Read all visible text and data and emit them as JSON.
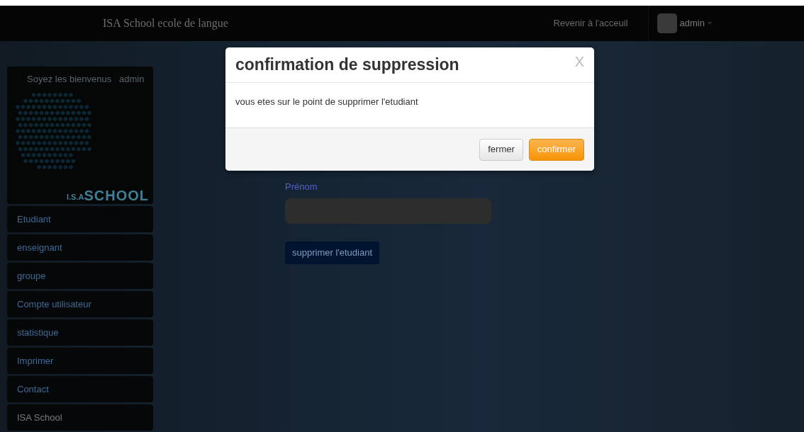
{
  "navbar": {
    "brand": "ISA School ecole de langue",
    "links": [
      {
        "label": "Revenir à l'acceuil"
      }
    ],
    "user": {
      "name": "admin"
    }
  },
  "sidebar": {
    "welcome": "Soyez les bienvenus   admin",
    "logo": {
      "small": "I.S.A",
      "big": "SCHOOL"
    },
    "items": [
      {
        "label": "Etudiant",
        "kind": "link"
      },
      {
        "label": "enseignant",
        "kind": "link"
      },
      {
        "label": "groupe",
        "kind": "link"
      },
      {
        "label": "Compte utilisateur",
        "kind": "link"
      },
      {
        "label": "statistique",
        "kind": "link"
      },
      {
        "label": "Imprimer",
        "kind": "link"
      },
      {
        "label": "Contact",
        "kind": "link"
      },
      {
        "label": "ISA School",
        "kind": "plain"
      }
    ]
  },
  "form": {
    "field": {
      "label": "Prénom"
    },
    "submit": "supprimer l'etudiant"
  },
  "modal": {
    "title": "confirmation de suppression",
    "close": "X",
    "body": "vous etes sur le point de supprimer l'etudiant",
    "buttons": [
      {
        "label": "fermer",
        "kind": "default"
      },
      {
        "label": "confirmer",
        "kind": "warning"
      }
    ]
  }
}
